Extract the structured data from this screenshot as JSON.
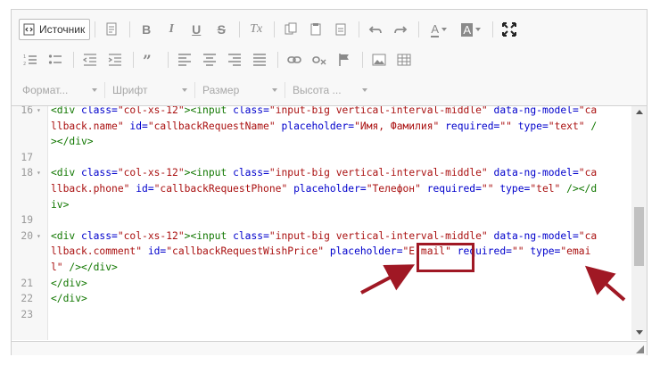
{
  "toolbar": {
    "source_label": "Источник",
    "row1_icons": [
      {
        "name": "document-icon"
      },
      {
        "name": "bold-icon",
        "glyph": "B"
      },
      {
        "name": "italic-icon",
        "glyph": "I"
      },
      {
        "name": "underline-icon",
        "glyph": "U"
      },
      {
        "name": "strikethrough-icon",
        "glyph": "S"
      },
      {
        "name": "remove-format-icon",
        "glyph": "Tx"
      },
      {
        "name": "copy-icon"
      },
      {
        "name": "paste-icon"
      },
      {
        "name": "paste-text-icon"
      },
      {
        "name": "undo-icon"
      },
      {
        "name": "redo-icon"
      },
      {
        "name": "text-color-icon",
        "glyph": "A"
      },
      {
        "name": "background-color-icon",
        "glyph": "A"
      },
      {
        "name": "maximize-icon"
      }
    ],
    "row2_icons": [
      {
        "name": "numbered-list-icon"
      },
      {
        "name": "bulleted-list-icon"
      },
      {
        "name": "outdent-icon"
      },
      {
        "name": "indent-icon"
      },
      {
        "name": "blockquote-icon"
      },
      {
        "name": "align-left-icon"
      },
      {
        "name": "align-center-icon"
      },
      {
        "name": "align-right-icon"
      },
      {
        "name": "justify-icon"
      },
      {
        "name": "link-icon"
      },
      {
        "name": "unlink-icon"
      },
      {
        "name": "anchor-icon"
      },
      {
        "name": "image-icon"
      },
      {
        "name": "table-icon"
      }
    ],
    "combos": [
      {
        "label": "Формат..."
      },
      {
        "label": "Шрифт"
      },
      {
        "label": "Размер"
      },
      {
        "label": "Высота ..."
      }
    ]
  },
  "code": {
    "lines": [
      {
        "num": "16",
        "fold": true,
        "segments": [
          [
            "tag",
            "<div "
          ],
          [
            "attr",
            "class="
          ],
          [
            "str",
            "\"col-xs-12\""
          ],
          [
            "tag",
            "><input "
          ],
          [
            "attr",
            "class="
          ],
          [
            "str",
            "\"input-big vertical-interval-middle\" "
          ],
          [
            "attr",
            "data-ng-model="
          ],
          [
            "str",
            "\"ca"
          ]
        ]
      },
      {
        "num": "",
        "fold": false,
        "segments": [
          [
            "str",
            "llback.name\" "
          ],
          [
            "attr",
            "id="
          ],
          [
            "str",
            "\"callbackRequestName\" "
          ],
          [
            "attr",
            "placeholder="
          ],
          [
            "str",
            "\"Имя, Фамилия\" "
          ],
          [
            "attr",
            "required="
          ],
          [
            "str",
            "\"\" "
          ],
          [
            "attr",
            "type="
          ],
          [
            "str",
            "\"text\" "
          ],
          [
            "tag",
            "/"
          ]
        ]
      },
      {
        "num": "",
        "fold": false,
        "segments": [
          [
            "tag",
            "></div>"
          ]
        ]
      },
      {
        "num": "17",
        "fold": false,
        "segments": []
      },
      {
        "num": "18",
        "fold": true,
        "segments": [
          [
            "tag",
            "<div "
          ],
          [
            "attr",
            "class="
          ],
          [
            "str",
            "\"col-xs-12\""
          ],
          [
            "tag",
            "><input "
          ],
          [
            "attr",
            "class="
          ],
          [
            "str",
            "\"input-big vertical-interval-middle\" "
          ],
          [
            "attr",
            "data-ng-model="
          ],
          [
            "str",
            "\"ca"
          ]
        ]
      },
      {
        "num": "",
        "fold": false,
        "segments": [
          [
            "str",
            "llback.phone\" "
          ],
          [
            "attr",
            "id="
          ],
          [
            "str",
            "\"callbackRequestPhone\" "
          ],
          [
            "attr",
            "placeholder="
          ],
          [
            "str",
            "\"Телефон\" "
          ],
          [
            "attr",
            "required="
          ],
          [
            "str",
            "\"\" "
          ],
          [
            "attr",
            "type="
          ],
          [
            "str",
            "\"tel\" "
          ],
          [
            "tag",
            "/></d"
          ]
        ]
      },
      {
        "num": "",
        "fold": false,
        "segments": [
          [
            "tag",
            "iv>"
          ]
        ]
      },
      {
        "num": "19",
        "fold": false,
        "segments": []
      },
      {
        "num": "20",
        "fold": true,
        "segments": [
          [
            "tag",
            "<div "
          ],
          [
            "attr",
            "class="
          ],
          [
            "str",
            "\"col-xs-12\""
          ],
          [
            "tag",
            "><input "
          ],
          [
            "attr",
            "class="
          ],
          [
            "str",
            "\"input-big vertical-interval-middle\" "
          ],
          [
            "attr",
            "data-ng-model="
          ],
          [
            "str",
            "\"ca"
          ]
        ]
      },
      {
        "num": "",
        "fold": false,
        "segments": [
          [
            "str",
            "llback.comment\" "
          ],
          [
            "attr",
            "id="
          ],
          [
            "str",
            "\"callbackRequestWishPrice\" "
          ],
          [
            "attr",
            "placeholder="
          ],
          [
            "str",
            "\"E-mail\" "
          ],
          [
            "attr",
            "required="
          ],
          [
            "str",
            "\"\" "
          ],
          [
            "attr",
            "type="
          ],
          [
            "str",
            "\"emai"
          ]
        ]
      },
      {
        "num": "",
        "fold": false,
        "segments": [
          [
            "str",
            "l\" "
          ],
          [
            "tag",
            "/></div>"
          ]
        ]
      },
      {
        "num": "21",
        "fold": false,
        "segments": [
          [
            "tag",
            "</div>"
          ]
        ]
      },
      {
        "num": "22",
        "fold": false,
        "segments": [
          [
            "tag",
            "</div>"
          ]
        ]
      },
      {
        "num": "23",
        "fold": false,
        "segments": []
      }
    ]
  },
  "colors": {
    "tag": "#117700",
    "attr": "#0000cc",
    "str": "#aa1111",
    "annotation": "#a01824"
  }
}
